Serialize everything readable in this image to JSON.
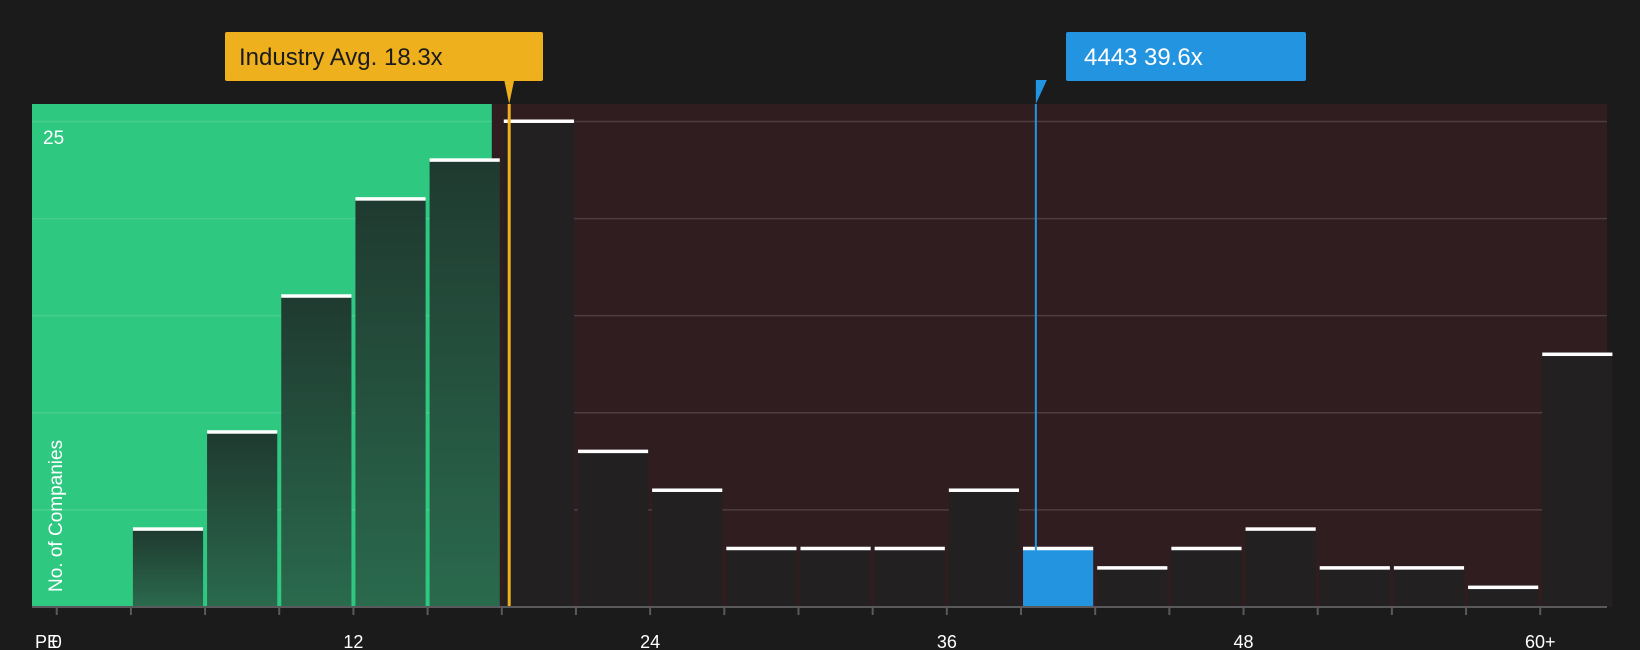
{
  "chart_data": {
    "type": "bar",
    "x_axis_label": "PE",
    "ylabel": "No. of Companies",
    "y_tick_labels": [
      {
        "value": 25,
        "label": "25"
      }
    ],
    "ylim": [
      0,
      25.9
    ],
    "xlim": [
      -1,
      62.7
    ],
    "x_ticks": [
      {
        "value": 0,
        "label": "0"
      },
      {
        "value": 12,
        "label": "12"
      },
      {
        "value": 24,
        "label": "24"
      },
      {
        "value": 36,
        "label": "36"
      },
      {
        "value": 48,
        "label": "48"
      },
      {
        "value": 60,
        "label": "60+"
      }
    ],
    "grid": true,
    "bin_width": 3,
    "bins": [
      {
        "start": 3,
        "count": 4
      },
      {
        "start": 6,
        "count": 9
      },
      {
        "start": 9,
        "count": 16
      },
      {
        "start": 12,
        "count": 21
      },
      {
        "start": 15,
        "count": 23
      },
      {
        "start": 18,
        "count": 25
      },
      {
        "start": 21,
        "count": 8
      },
      {
        "start": 24,
        "count": 6
      },
      {
        "start": 27,
        "count": 3
      },
      {
        "start": 30,
        "count": 3
      },
      {
        "start": 33,
        "count": 3
      },
      {
        "start": 36,
        "count": 6
      },
      {
        "start": 39,
        "count": 3,
        "highlight": true
      },
      {
        "start": 42,
        "count": 2
      },
      {
        "start": 45,
        "count": 3
      },
      {
        "start": 48,
        "count": 4
      },
      {
        "start": 51,
        "count": 2
      },
      {
        "start": 54,
        "count": 2
      },
      {
        "start": 57,
        "count": 1
      },
      {
        "start": 60,
        "count": 13
      }
    ],
    "industry_avg": {
      "value": 18.3,
      "label": "Industry Avg. 18.3x"
    },
    "company": {
      "value": 39.6,
      "label": "4443 39.6x"
    },
    "fair_region_end": 17.6
  },
  "colors": {
    "background": "#1b1b1c",
    "green_region": "#2ec880",
    "red_region": "#2f1d1f",
    "bar_dark": "#232021",
    "bar_green_top": "#1f3a30",
    "bar_green_bottom": "#2a6a4d",
    "highlight_bar": "#2394e0",
    "industry_callout": "#eeb01c",
    "company_callout": "#2394e0",
    "bar_cap": "#ffffff"
  }
}
